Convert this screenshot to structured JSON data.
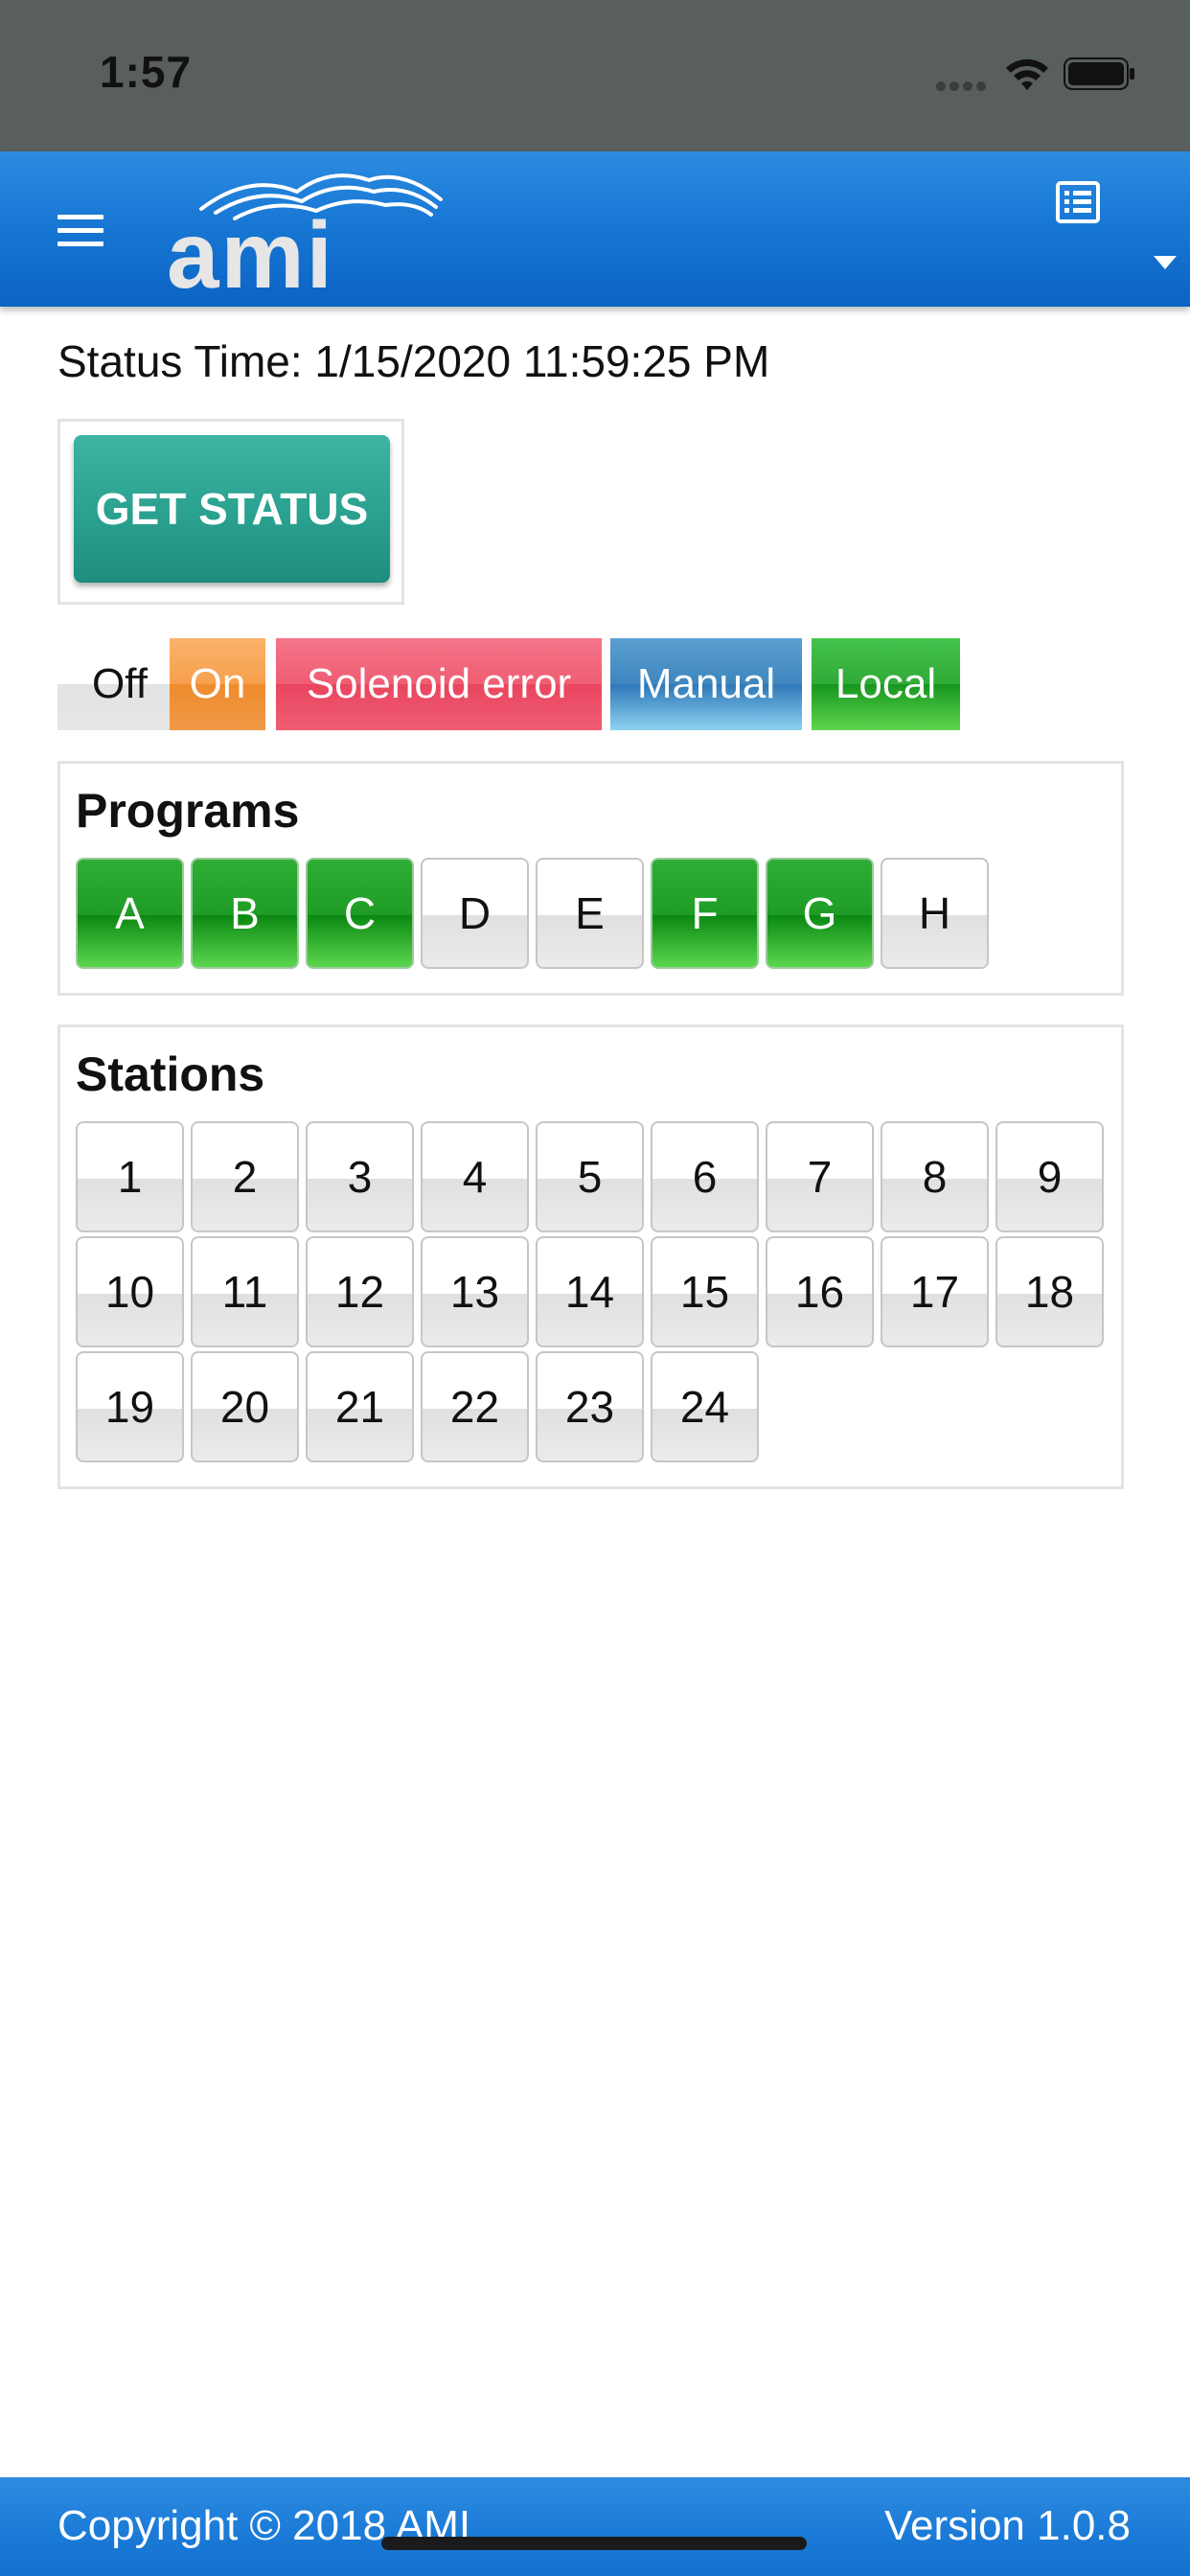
{
  "system": {
    "time": "1:57"
  },
  "header": {
    "logo_text": "ami",
    "menu_icon": "hamburger-menu-icon",
    "list_icon": "list-icon"
  },
  "status": {
    "label": "Status Time: 1/15/2020 11:59:25 PM",
    "get_status_label": "GET STATUS"
  },
  "legend": [
    {
      "label": "Off",
      "color": "#e5e5e5"
    },
    {
      "label": "On",
      "color": "#f39a43"
    },
    {
      "label": "Solenoid error",
      "color": "#ec546b"
    },
    {
      "label": "Manual",
      "color": "#3a83bd"
    },
    {
      "label": "Local",
      "color": "#23a02b"
    }
  ],
  "programs": {
    "title": "Programs",
    "items": [
      {
        "label": "A",
        "active": true
      },
      {
        "label": "B",
        "active": true
      },
      {
        "label": "C",
        "active": true
      },
      {
        "label": "D",
        "active": false
      },
      {
        "label": "E",
        "active": false
      },
      {
        "label": "F",
        "active": true
      },
      {
        "label": "G",
        "active": true
      },
      {
        "label": "H",
        "active": false
      }
    ]
  },
  "stations": {
    "title": "Stations",
    "items": [
      "1",
      "2",
      "3",
      "4",
      "5",
      "6",
      "7",
      "8",
      "9",
      "10",
      "11",
      "12",
      "13",
      "14",
      "15",
      "16",
      "17",
      "18",
      "19",
      "20",
      "21",
      "22",
      "23",
      "24"
    ]
  },
  "footer": {
    "copyright": "Copyright © 2018 AMI",
    "version": "Version 1.0.8"
  },
  "colors": {
    "header_blue": "#1a7ad6",
    "teal_button": "#2aa08f",
    "active_green": "#1e9c25"
  }
}
